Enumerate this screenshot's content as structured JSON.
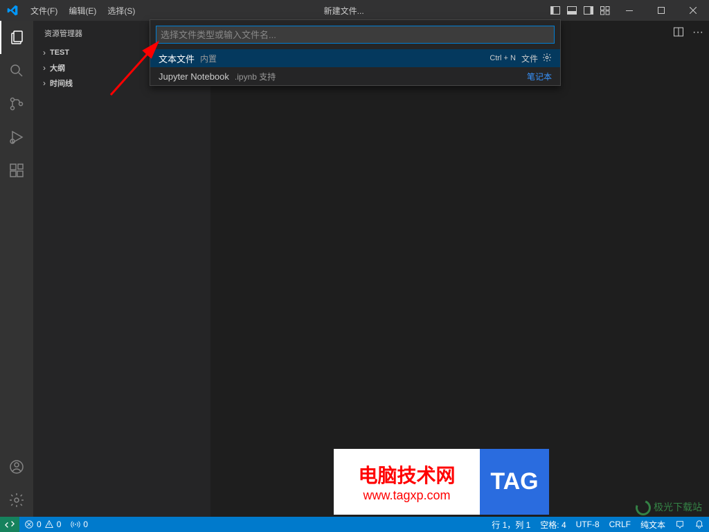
{
  "titlebar": {
    "menu": [
      "文件(F)",
      "编辑(E)",
      "选择(S)"
    ],
    "center": "新建文件..."
  },
  "sidebar": {
    "title": "资源管理器",
    "items": [
      {
        "label": "TEST"
      },
      {
        "label": "大纲"
      },
      {
        "label": "时间线"
      }
    ]
  },
  "quickpick": {
    "placeholder": "选择文件类型或输入文件名...",
    "items": [
      {
        "label": "文本文件",
        "desc": "内置",
        "keybinding": "Ctrl  +  N",
        "category": "文件",
        "selected": true,
        "gear": true
      },
      {
        "label": "Jupyter Notebook",
        "desc": ".ipynb 支持",
        "category": "笔记本",
        "link": true
      }
    ]
  },
  "statusbar": {
    "errors": "0",
    "warnings": "0",
    "port": "0",
    "ln_col": "行 1，列 1",
    "spaces": "空格: 4",
    "encoding": "UTF-8",
    "eol": "CRLF",
    "lang": "纯文本"
  },
  "watermark": {
    "text1": "电脑技术网",
    "text2": "www.tagxp.com",
    "tag": "TAG",
    "site2": "极光下载站"
  }
}
